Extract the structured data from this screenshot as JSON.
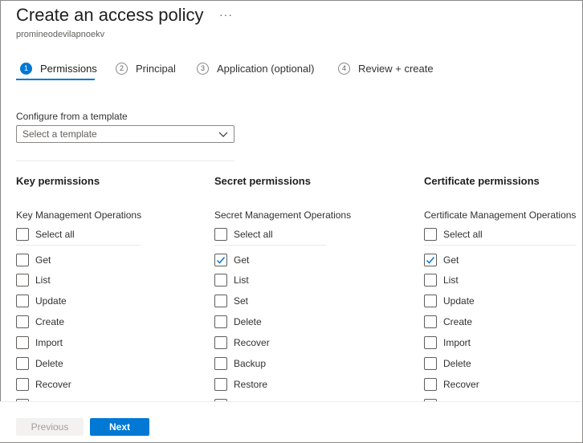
{
  "header": {
    "title": "Create an access policy",
    "more_label": "···",
    "subtitle": "promineodevilapnoekv"
  },
  "steps": [
    {
      "num": "1",
      "label": "Permissions",
      "active": true
    },
    {
      "num": "2",
      "label": "Principal",
      "active": false
    },
    {
      "num": "3",
      "label": "Application (optional)",
      "active": false
    },
    {
      "num": "4",
      "label": "Review + create",
      "active": false
    }
  ],
  "template": {
    "label": "Configure from a template",
    "placeholder": "Select a template"
  },
  "columns": {
    "key": {
      "title": "Key permissions",
      "group": "Key Management Operations",
      "items": [
        {
          "label": "Select all",
          "checked": false
        },
        {
          "label": "Get",
          "checked": false
        },
        {
          "label": "List",
          "checked": false
        },
        {
          "label": "Update",
          "checked": false
        },
        {
          "label": "Create",
          "checked": false
        },
        {
          "label": "Import",
          "checked": false
        },
        {
          "label": "Delete",
          "checked": false
        },
        {
          "label": "Recover",
          "checked": false
        }
      ]
    },
    "secret": {
      "title": "Secret permissions",
      "group": "Secret Management Operations",
      "items": [
        {
          "label": "Select all",
          "checked": false
        },
        {
          "label": "Get",
          "checked": true
        },
        {
          "label": "List",
          "checked": false
        },
        {
          "label": "Set",
          "checked": false
        },
        {
          "label": "Delete",
          "checked": false
        },
        {
          "label": "Recover",
          "checked": false
        },
        {
          "label": "Backup",
          "checked": false
        },
        {
          "label": "Restore",
          "checked": false
        }
      ]
    },
    "certificate": {
      "title": "Certificate permissions",
      "group": "Certificate Management Operations",
      "items": [
        {
          "label": "Select all",
          "checked": false
        },
        {
          "label": "Get",
          "checked": true
        },
        {
          "label": "List",
          "checked": false
        },
        {
          "label": "Update",
          "checked": false
        },
        {
          "label": "Create",
          "checked": false
        },
        {
          "label": "Import",
          "checked": false
        },
        {
          "label": "Delete",
          "checked": false
        },
        {
          "label": "Recover",
          "checked": false
        }
      ]
    }
  },
  "footer": {
    "previous_label": "Previous",
    "next_label": "Next"
  },
  "colors": {
    "accent": "#0078d4",
    "border": "#8a8886"
  }
}
